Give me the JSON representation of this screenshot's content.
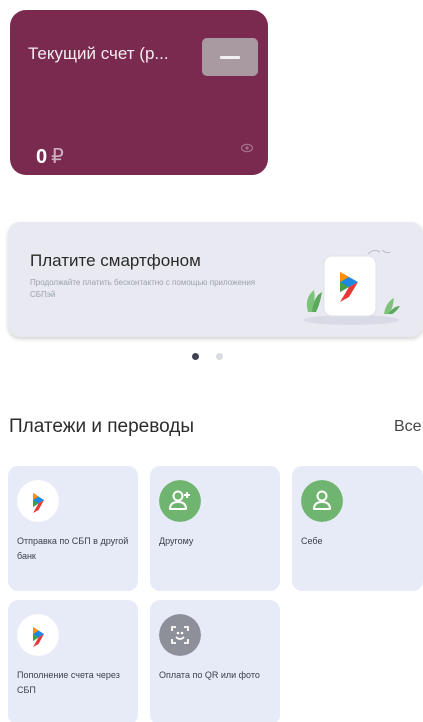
{
  "account": {
    "title": "Текущий счет (р...",
    "balance": "0",
    "currency": "₽",
    "background_color": "#7a2a4f"
  },
  "promo_banner": {
    "title": "Платите смартфоном",
    "subtitle": "Продолжайте платить бесконтактно с помощью приложения СБПэй"
  },
  "carousel": {
    "total": 2,
    "active_index": 0
  },
  "payments": {
    "section_title": "Платежи и переводы",
    "see_all_label": "Все",
    "tiles": [
      {
        "label": "Отправка по СБП в другой банк",
        "icon": "sbp-logo-icon"
      },
      {
        "label": "Другому",
        "icon": "person-add-icon"
      },
      {
        "label": "Себе",
        "icon": "person-icon"
      },
      {
        "label": "Пополнение счета через СБП",
        "icon": "sbp-logo-icon"
      },
      {
        "label": "Оплата по QR или фото",
        "icon": "qr-scan-icon"
      }
    ]
  },
  "colors": {
    "tile_background": "#e7ebf8",
    "green_icon": "#6fb46f",
    "gray_icon": "#8d9099"
  }
}
